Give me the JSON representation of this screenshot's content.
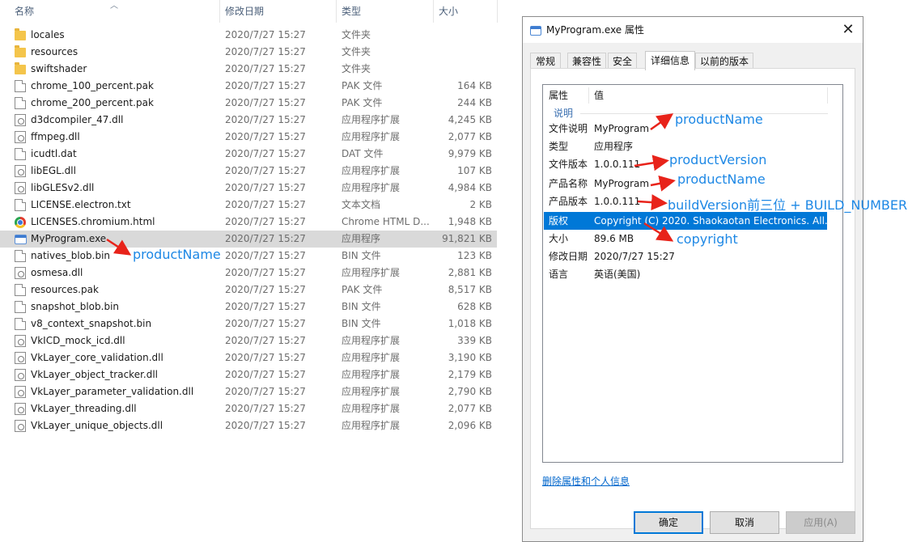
{
  "explorer": {
    "columns": {
      "name": "名称",
      "date": "修改日期",
      "type": "类型",
      "size": "大小"
    },
    "files": [
      {
        "icon": "folder-icon",
        "name": "locales",
        "date": "2020/7/27 15:27",
        "type": "文件夹",
        "size": ""
      },
      {
        "icon": "folder-icon",
        "name": "resources",
        "date": "2020/7/27 15:27",
        "type": "文件夹",
        "size": ""
      },
      {
        "icon": "folder-icon",
        "name": "swiftshader",
        "date": "2020/7/27 15:27",
        "type": "文件夹",
        "size": ""
      },
      {
        "icon": "file-icon",
        "name": "chrome_100_percent.pak",
        "date": "2020/7/27 15:27",
        "type": "PAK 文件",
        "size": "164 KB"
      },
      {
        "icon": "file-icon",
        "name": "chrome_200_percent.pak",
        "date": "2020/7/27 15:27",
        "type": "PAK 文件",
        "size": "244 KB"
      },
      {
        "icon": "dll-icon",
        "name": "d3dcompiler_47.dll",
        "date": "2020/7/27 15:27",
        "type": "应用程序扩展",
        "size": "4,245 KB"
      },
      {
        "icon": "dll-icon",
        "name": "ffmpeg.dll",
        "date": "2020/7/27 15:27",
        "type": "应用程序扩展",
        "size": "2,077 KB"
      },
      {
        "icon": "file-icon",
        "name": "icudtl.dat",
        "date": "2020/7/27 15:27",
        "type": "DAT 文件",
        "size": "9,979 KB"
      },
      {
        "icon": "dll-icon",
        "name": "libEGL.dll",
        "date": "2020/7/27 15:27",
        "type": "应用程序扩展",
        "size": "107 KB"
      },
      {
        "icon": "dll-icon",
        "name": "libGLESv2.dll",
        "date": "2020/7/27 15:27",
        "type": "应用程序扩展",
        "size": "4,984 KB"
      },
      {
        "icon": "file-icon",
        "name": "LICENSE.electron.txt",
        "date": "2020/7/27 15:27",
        "type": "文本文档",
        "size": "2 KB"
      },
      {
        "icon": "chrome-icon",
        "name": "LICENSES.chromium.html",
        "date": "2020/7/27 15:27",
        "type": "Chrome HTML D...",
        "size": "1,948 KB"
      },
      {
        "icon": "exe-icon",
        "name": "MyProgram.exe",
        "date": "2020/7/27 15:27",
        "type": "应用程序",
        "size": "91,821 KB",
        "selected": true
      },
      {
        "icon": "file-icon",
        "name": "natives_blob.bin",
        "date": "2020/7/27 15:27",
        "type": "BIN 文件",
        "size": "123 KB"
      },
      {
        "icon": "dll-icon",
        "name": "osmesa.dll",
        "date": "2020/7/27 15:27",
        "type": "应用程序扩展",
        "size": "2,881 KB"
      },
      {
        "icon": "file-icon",
        "name": "resources.pak",
        "date": "2020/7/27 15:27",
        "type": "PAK 文件",
        "size": "8,517 KB"
      },
      {
        "icon": "file-icon",
        "name": "snapshot_blob.bin",
        "date": "2020/7/27 15:27",
        "type": "BIN 文件",
        "size": "628 KB"
      },
      {
        "icon": "file-icon",
        "name": "v8_context_snapshot.bin",
        "date": "2020/7/27 15:27",
        "type": "BIN 文件",
        "size": "1,018 KB"
      },
      {
        "icon": "dll-icon",
        "name": "VkICD_mock_icd.dll",
        "date": "2020/7/27 15:27",
        "type": "应用程序扩展",
        "size": "339 KB"
      },
      {
        "icon": "dll-icon",
        "name": "VkLayer_core_validation.dll",
        "date": "2020/7/27 15:27",
        "type": "应用程序扩展",
        "size": "3,190 KB"
      },
      {
        "icon": "dll-icon",
        "name": "VkLayer_object_tracker.dll",
        "date": "2020/7/27 15:27",
        "type": "应用程序扩展",
        "size": "2,179 KB"
      },
      {
        "icon": "dll-icon",
        "name": "VkLayer_parameter_validation.dll",
        "date": "2020/7/27 15:27",
        "type": "应用程序扩展",
        "size": "2,790 KB"
      },
      {
        "icon": "dll-icon",
        "name": "VkLayer_threading.dll",
        "date": "2020/7/27 15:27",
        "type": "应用程序扩展",
        "size": "2,077 KB"
      },
      {
        "icon": "dll-icon",
        "name": "VkLayer_unique_objects.dll",
        "date": "2020/7/27 15:27",
        "type": "应用程序扩展",
        "size": "2,096 KB"
      }
    ]
  },
  "dialog": {
    "title": "MyProgram.exe 属性",
    "close_glyph": "✕",
    "tabs": [
      "常规",
      "兼容性",
      "安全",
      "详细信息",
      "以前的版本"
    ],
    "active_tab": "详细信息",
    "grid_headers": {
      "property": "属性",
      "value": "值"
    },
    "group": "说明",
    "properties": [
      {
        "key": "文件说明",
        "value": "MyProgram"
      },
      {
        "key": "类型",
        "value": "应用程序"
      },
      {
        "key": "文件版本",
        "value": "1.0.0.111"
      },
      {
        "key": "产品名称",
        "value": "MyProgram"
      },
      {
        "key": "产品版本",
        "value": "1.0.0.111"
      },
      {
        "key": "版权",
        "value": "Copyright (C) 2020. Shaokaotan Electronics. All...",
        "selected": true
      },
      {
        "key": "大小",
        "value": "89.6 MB"
      },
      {
        "key": "修改日期",
        "value": "2020/7/27 15:27"
      },
      {
        "key": "语言",
        "value": "英语(美国)"
      }
    ],
    "remove_link": "删除属性和个人信息",
    "buttons": {
      "ok": "确定",
      "cancel": "取消",
      "apply": "应用(A)"
    }
  },
  "annotations": {
    "list_product_name": "productName",
    "file_description": "productName",
    "file_version": "productVersion",
    "product_name": "productName",
    "product_version": "buildVersion前三位 + BUILD_NUMBER",
    "copyright": "copyright",
    "arrow_color": "#e8231a",
    "text_color": "#1e88e5"
  }
}
